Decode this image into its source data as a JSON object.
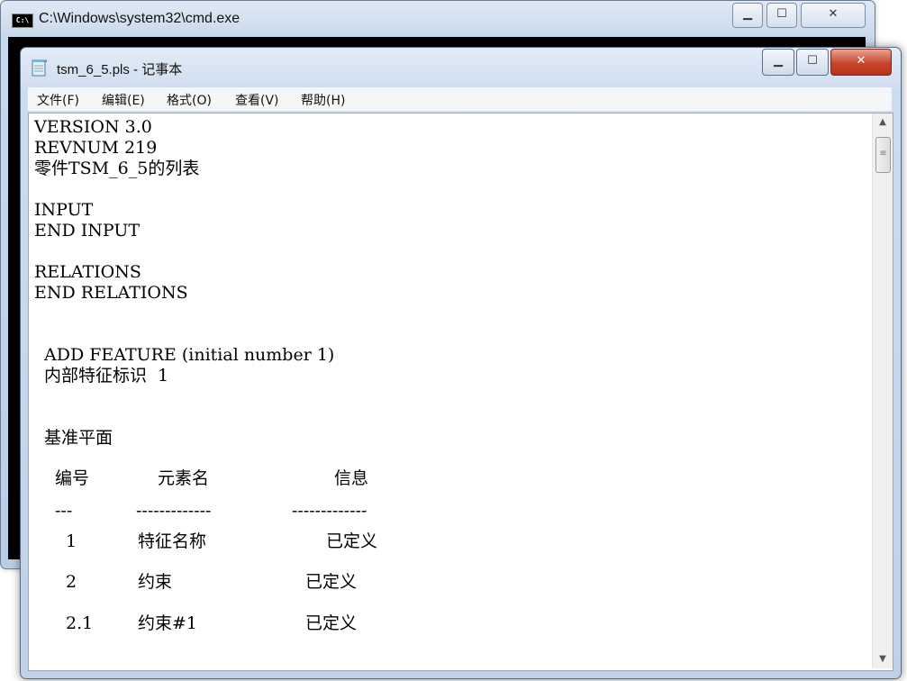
{
  "cmd_window": {
    "title": "C:\\Windows\\system32\\cmd.exe",
    "icon": "console-icon",
    "icon_text": "C:\\",
    "min_glyph": "▁",
    "max_glyph": "☐",
    "close_glyph": "✕"
  },
  "notepad": {
    "title": "tsm_6_5.pls - 记事本",
    "icon": "notepad-icon",
    "min_glyph": "▁",
    "max_glyph": "☐",
    "close_glyph": "✕",
    "menu": {
      "file": "文件(F)",
      "edit": "编辑(E)",
      "format": "格式(O)",
      "view": "查看(V)",
      "help": "帮助(H)"
    },
    "content": {
      "line1": "VERSION 3.0",
      "line2": "REVNUM 219",
      "line3": "零件TSM_6_5的列表",
      "line5": "INPUT",
      "line6": "END INPUT",
      "line8": "RELATIONS",
      "line9": "END RELATIONS",
      "line12": "ADD FEATURE (initial number 1)",
      "line13": "内部特征标识  1",
      "line16": "基准平面",
      "header_no": "编号",
      "header_name": "元素名",
      "header_info": "信息",
      "sep_no": "---",
      "sep_name": "-------------",
      "sep_info": "-------------",
      "rows": [
        {
          "no": "1",
          "name": "特征名称",
          "info": "已定义"
        },
        {
          "no": "2",
          "name": "约束",
          "info": "已定义"
        },
        {
          "no": "2.1",
          "name": "约束#1",
          "info": "已定义"
        }
      ]
    },
    "scrollbar": {
      "up_glyph": "▲",
      "down_glyph": "▼",
      "thumb_glyph": "≡"
    }
  }
}
